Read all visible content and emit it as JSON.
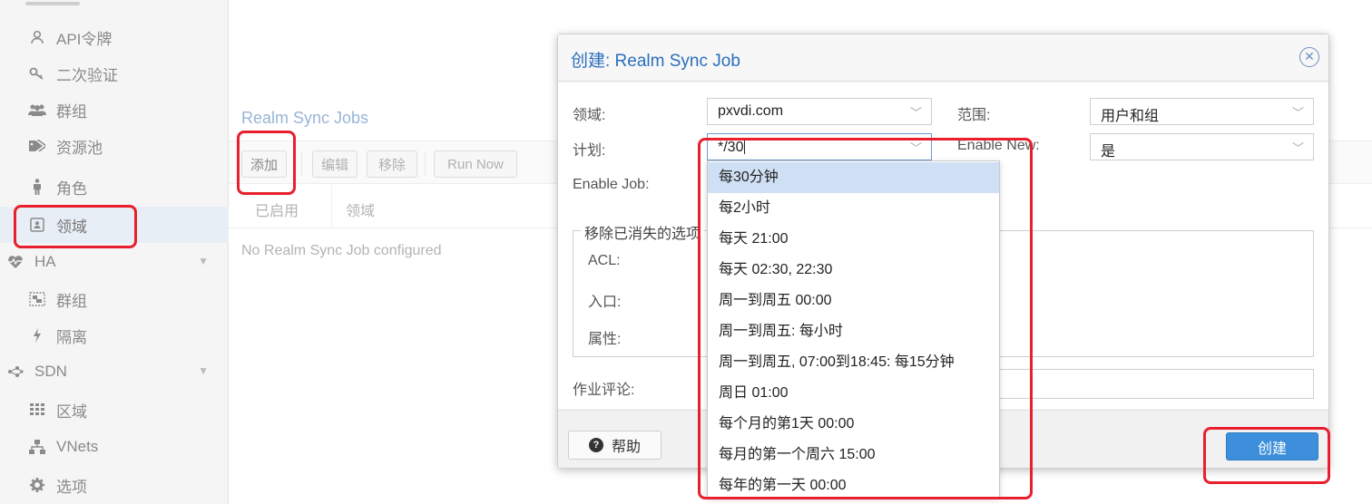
{
  "sidebar": {
    "items": [
      {
        "icon": "key-icon",
        "label": "API令牌"
      },
      {
        "icon": "two-factor-key-icon",
        "label": "二次验证"
      },
      {
        "icon": "users-icon",
        "label": "群组"
      },
      {
        "icon": "tags-icon",
        "label": "资源池"
      },
      {
        "icon": "male-icon",
        "label": "角色"
      },
      {
        "icon": "address-book-icon",
        "label": "领域"
      },
      {
        "icon": "heartbeat-icon",
        "label": "HA"
      },
      {
        "icon": "object-group-icon",
        "label": "群组"
      },
      {
        "icon": "bolt-icon",
        "label": "隔离"
      },
      {
        "icon": "sdn-icon",
        "label": "SDN"
      },
      {
        "icon": "grid-icon",
        "label": "区域"
      },
      {
        "icon": "sitemap-icon",
        "label": "VNets"
      },
      {
        "icon": "gear-icon",
        "label": "选项"
      }
    ]
  },
  "main": {
    "title": "Realm Sync Jobs",
    "toolbar": {
      "add": "添加",
      "edit": "编辑",
      "remove": "移除",
      "run_now": "Run Now"
    },
    "columns": [
      "已启用",
      "领域"
    ],
    "empty_text": "No Realm Sync Job configured"
  },
  "dialog": {
    "title": "创建: Realm Sync Job",
    "realm_label": "领域:",
    "realm_value": "pxvdi.com",
    "scope_label": "范围:",
    "scope_value": "用户和组",
    "schedule_label": "计划:",
    "schedule_value": "*/30",
    "enable_new_label": "Enable New:",
    "enable_new_value": "是",
    "enable_job_label": "Enable Job:",
    "fieldset_legend": "移除已消失的选项",
    "acl_label": "ACL:",
    "entry_label": "入口:",
    "property_label": "属性:",
    "comment_label": "作业评论:",
    "help_button": "帮助",
    "create_button": "创建"
  },
  "dropdown": {
    "options": [
      "每30分钟",
      "每2小时",
      "每天 21:00",
      "每天 02:30, 22:30",
      "周一到周五 00:00",
      "周一到周五: 每小时",
      "周一到周五, 07:00到18:45: 每15分钟",
      "周日 01:00",
      "每个月的第1天 00:00",
      "每月的第一个周六 15:00",
      "每年的第一天 00:00"
    ],
    "selected_index": 0
  },
  "colors": {
    "accent": "#3d8fdb",
    "title_blue": "#2a6ebb",
    "highlight_red": "#e8202e",
    "selected_row": "#cfe0f4"
  }
}
